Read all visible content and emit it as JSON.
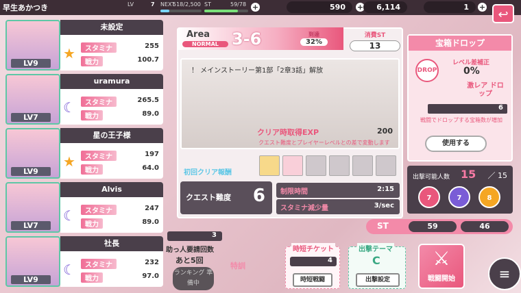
{
  "player": {
    "name": "早生あかつき",
    "lv_label": "LV",
    "lv": "7",
    "next_label": "NEXT",
    "next": "518/2,500",
    "st_label": "ST",
    "st": "59/78"
  },
  "currency": {
    "gem": "590",
    "coin": "6,114",
    "ticket": "1",
    "plus": "+"
  },
  "back_icon": "↩",
  "party": [
    {
      "name": "未設定",
      "lv": "LV9",
      "stamina_label": "スタミナ",
      "stamina": "255",
      "power_label": "戦力",
      "power": "100.7",
      "attr_icon": "star",
      "attr_color": "#f5a623"
    },
    {
      "name": "uramura",
      "lv": "LV7",
      "stamina_label": "スタミナ",
      "stamina": "265.5",
      "power_label": "戦力",
      "power": "89.0",
      "attr_icon": "moon",
      "attr_color": "#7a5cd6"
    },
    {
      "name": "星の王子様",
      "lv": "LV9",
      "stamina_label": "スタミナ",
      "stamina": "197",
      "power_label": "戦力",
      "power": "64.0",
      "attr_icon": "star",
      "attr_color": "#f5a623"
    },
    {
      "name": "Alvis",
      "lv": "LV7",
      "stamina_label": "スタミナ",
      "stamina": "247",
      "power_label": "戦力",
      "power": "89.0",
      "attr_icon": "moon",
      "attr_color": "#7a5cd6"
    },
    {
      "name": "社長",
      "lv": "LV9",
      "stamina_label": "スタミナ",
      "stamina": "232",
      "power_label": "戦力",
      "power": "97.0",
      "attr_icon": "moon",
      "attr_color": "#7a5cd6"
    }
  ],
  "area": {
    "label": "Area",
    "mode": "NORMAL",
    "stage": "3-6",
    "progress_label": "到達",
    "progress": "32%",
    "cost_label": "消費ST",
    "cost": "13"
  },
  "quest": {
    "unlock": "！ メインストーリー第1部「2章3話」解放",
    "exp_label": "クリア時取得EXP",
    "exp": "200",
    "exp_note": "クエスト難度とプレイヤーレベルとの差で変動します",
    "first_clear": "初回クリア報酬"
  },
  "difficulty": {
    "label": "クエスト難度",
    "value": "6",
    "time_label": "制限時間",
    "time": "2:15",
    "stamina_label": "スタミナ減少量",
    "stamina": "3/sec"
  },
  "drop": {
    "title": "宝箱ドロップ",
    "icon": "DROP",
    "lv_label": "レベル差補正",
    "lv_value": "0%",
    "rare": "激レア ドロップ",
    "count": "6",
    "desc": "戦闘でドロップする宝箱数が増加",
    "use": "使用する"
  },
  "sortie": {
    "label": "出撃可能人数",
    "current": "15",
    "sep": "／",
    "max": "15",
    "attrs": [
      "7",
      "7",
      "8"
    ]
  },
  "st": {
    "label": "ST",
    "before": "59",
    "after": "46"
  },
  "helper": {
    "count": "3",
    "label1": "助っ人要請回数",
    "label2": "あと5回",
    "rank": "ランキング 準備中"
  },
  "special": "特訓",
  "time_ticket": {
    "title": "時短チケット",
    "count": "4",
    "button": "時短戦闘"
  },
  "sortie_theme": {
    "title": "出撃テーマ",
    "value": "C",
    "button": "出撃設定"
  },
  "battle": {
    "label": "戦闘開始"
  },
  "menu_icon": "≡"
}
